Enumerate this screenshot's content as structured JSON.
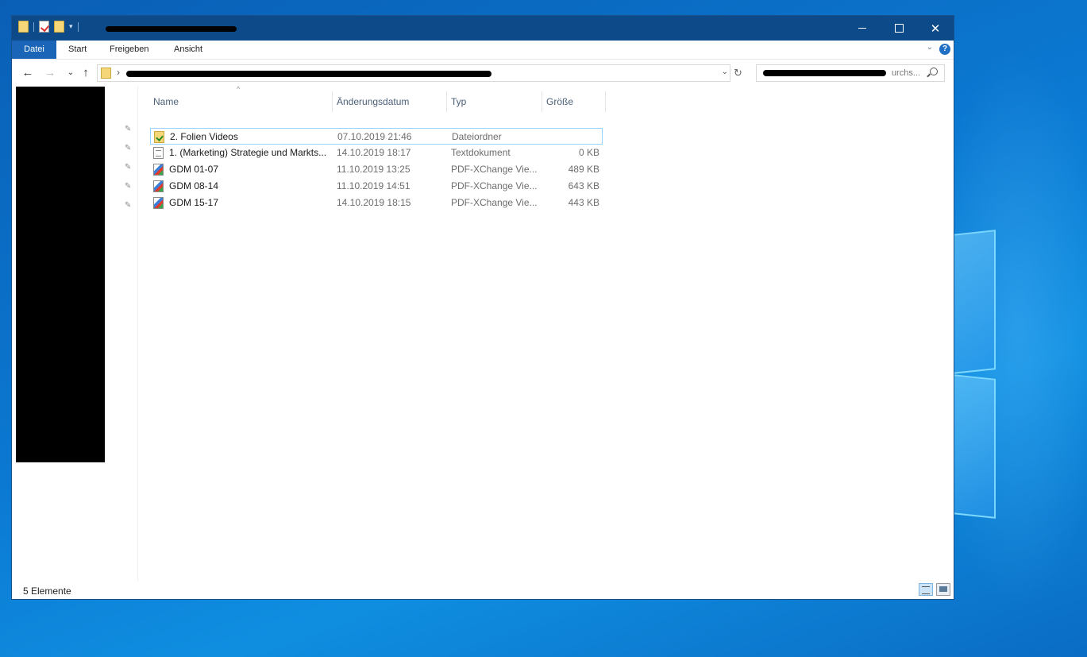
{
  "window": {
    "ribbon_tabs": [
      "Datei",
      "Start",
      "Freigeben",
      "Ansicht"
    ],
    "help": "?"
  },
  "search": {
    "placeholder": "urchs..."
  },
  "columns": {
    "name": "Name",
    "date": "Änderungsdatum",
    "type": "Typ",
    "size": "Größe"
  },
  "files": [
    {
      "name": "2. Folien Videos",
      "date": "07.10.2019 21:46",
      "type": "Dateiordner",
      "size": "",
      "icon": "folder-icon",
      "selected": true
    },
    {
      "name": "1. (Marketing) Strategie und Markts...",
      "date": "14.10.2019 18:17",
      "type": "Textdokument",
      "size": "0 KB",
      "icon": "text-document-icon"
    },
    {
      "name": "GDM 01-07",
      "date": "11.10.2019 13:25",
      "type": "PDF-XChange Vie...",
      "size": "489 KB",
      "icon": "pdf-icon"
    },
    {
      "name": "GDM 08-14",
      "date": "11.10.2019 14:51",
      "type": "PDF-XChange Vie...",
      "size": "643 KB",
      "icon": "pdf-icon"
    },
    {
      "name": "GDM 15-17",
      "date": "14.10.2019 18:15",
      "type": "PDF-XChange Vie...",
      "size": "443 KB",
      "icon": "pdf-icon"
    }
  ],
  "status": {
    "count": "5 Elemente"
  },
  "colors": {
    "titlebar": "#0c4a8a",
    "file_tab": "#1a65b8",
    "selection_border": "#99d1ff"
  }
}
